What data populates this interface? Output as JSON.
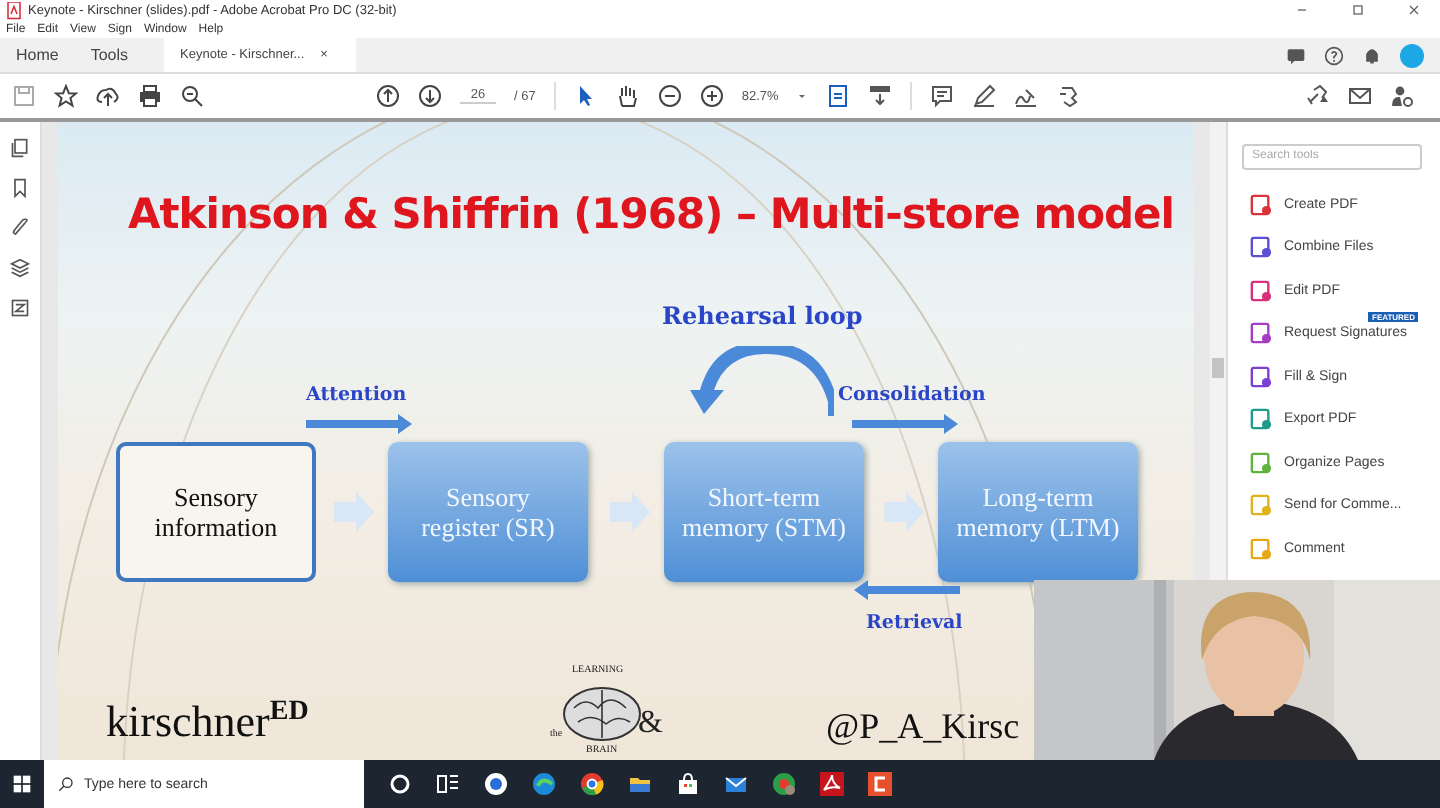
{
  "window": {
    "title": "Keynote - Kirschner (slides).pdf - Adobe Acrobat Pro DC (32-bit)"
  },
  "menu": [
    "File",
    "Edit",
    "View",
    "Sign",
    "Window",
    "Help"
  ],
  "tabs": [
    {
      "label": "Home",
      "selected": false
    },
    {
      "label": "Tools",
      "selected": false
    },
    {
      "label": "Keynote - Kirschner...",
      "selected": true,
      "close": "×"
    }
  ],
  "toolbar": {
    "page": "26",
    "page_count": "/ 67",
    "zoom": "82.7%"
  },
  "slide": {
    "title": "Atkinson & Shiffrin (1968) – Multi-store model",
    "boxes": [
      {
        "label": "Sensory information",
        "kind": "outline"
      },
      {
        "label": "Sensory register (SR)",
        "kind": "filled"
      },
      {
        "label": "Short-term memory (STM)",
        "kind": "filled"
      },
      {
        "label": "Long-term memory (LTM)",
        "kind": "filled"
      }
    ],
    "attention": "Attention",
    "rehearsal": "Rehearsal loop",
    "consolidation": "Consolidation",
    "retrieval": "Retrieval",
    "brand": "kirschner$^{ED}$",
    "logo_top": "LEARNING",
    "logo_the": "the",
    "logo_amp": "&",
    "logo_bottom": "BRAIN",
    "handle": "@P_A_Kirsc"
  },
  "tools_panel": {
    "search": {
      "placeholder": "Search tools"
    },
    "tools": [
      {
        "label": "Create PDF",
        "color": "#d9343a"
      },
      {
        "label": "Combine Files",
        "color": "#5b4fd6"
      },
      {
        "label": "Edit PDF",
        "color": "#d8307a"
      },
      {
        "label": "Request Signatures",
        "color": "#a43cc4",
        "badge": "FEATURED"
      },
      {
        "label": "Fill & Sign",
        "color": "#7b3fd1"
      },
      {
        "label": "Export PDF",
        "color": "#1f9a8c"
      },
      {
        "label": "Organize Pages",
        "color": "#5fb33c"
      },
      {
        "label": "Send for Comme...",
        "color": "#e0b21c"
      },
      {
        "label": "Comment",
        "color": "#e6a817"
      }
    ]
  },
  "taskbar": {
    "search": {
      "placeholder": "Type here to search"
    }
  }
}
